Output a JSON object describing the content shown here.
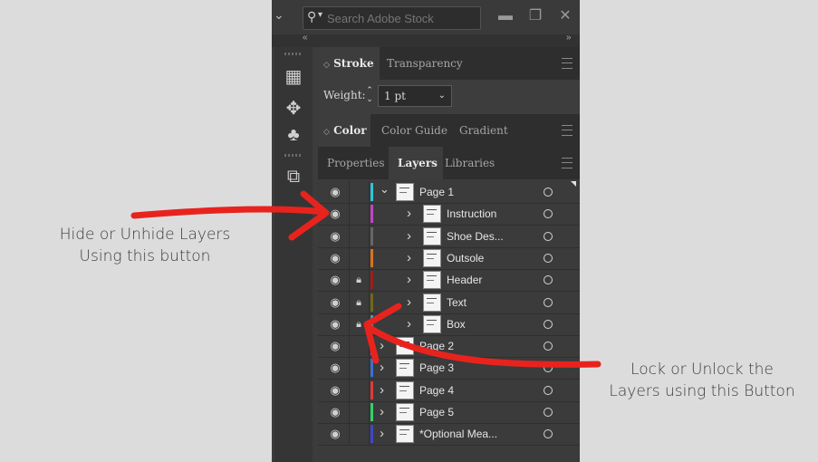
{
  "annotations": {
    "left_line1": "Hide or Unhide Layers",
    "left_line2": "Using this button",
    "right_line1": "Lock or Unlock the",
    "right_line2": "Layers using this Button"
  },
  "topbar": {
    "search_placeholder": "Search Adobe Stock"
  },
  "stroke_panel": {
    "tabs": [
      "Stroke",
      "Transparency"
    ],
    "weight_label": "Weight:",
    "weight_value": "1 pt"
  },
  "color_panel": {
    "tabs": [
      "Color",
      "Color Guide",
      "Gradient"
    ]
  },
  "layers_panel": {
    "tabs": [
      "Properties",
      "Layers",
      "Libraries"
    ],
    "layers": [
      {
        "name": "Page 1",
        "color": "#2ec4d8",
        "expanded": true,
        "level": 0,
        "locked": false
      },
      {
        "name": "Instruction",
        "color": "#c244c4",
        "level": 1,
        "locked": false
      },
      {
        "name": "Shoe Des...",
        "color": "#666666",
        "level": 1,
        "locked": false
      },
      {
        "name": "Outsole",
        "color": "#d9731e",
        "level": 1,
        "locked": false
      },
      {
        "name": "Header",
        "color": "#a11c1c",
        "level": 1,
        "locked": true
      },
      {
        "name": "Text",
        "color": "#6b6a1a",
        "level": 1,
        "locked": true
      },
      {
        "name": "Box",
        "color": "#25a7c9",
        "level": 1,
        "locked": true
      },
      {
        "name": "Page 2",
        "color": "#d23fb7",
        "level": 0,
        "locked": false
      },
      {
        "name": "Page 3",
        "color": "#3d6fd1",
        "level": 0,
        "locked": false
      },
      {
        "name": "Page 4",
        "color": "#e03a3a",
        "level": 0,
        "locked": false
      },
      {
        "name": "Page 5",
        "color": "#33d16a",
        "level": 0,
        "locked": false
      },
      {
        "name": "*Optional Mea...",
        "color": "#3f46c9",
        "level": 0,
        "locked": false
      }
    ]
  },
  "colors": {
    "arrow": "#e8231e"
  }
}
